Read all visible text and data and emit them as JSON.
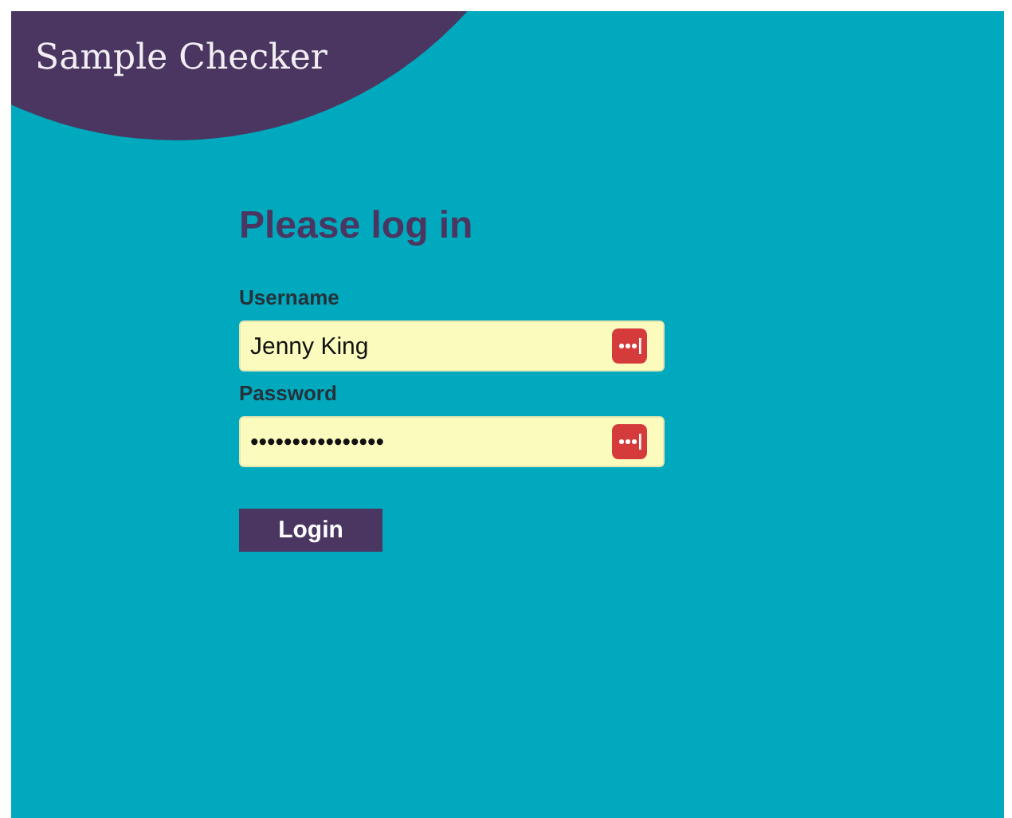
{
  "brand": {
    "title": "Sample Checker"
  },
  "form": {
    "heading": "Please log in",
    "fields": [
      {
        "label": "Username",
        "value": "Jenny King"
      },
      {
        "label": "Password",
        "value": "••••••••••••••••"
      }
    ],
    "button": "Login"
  }
}
